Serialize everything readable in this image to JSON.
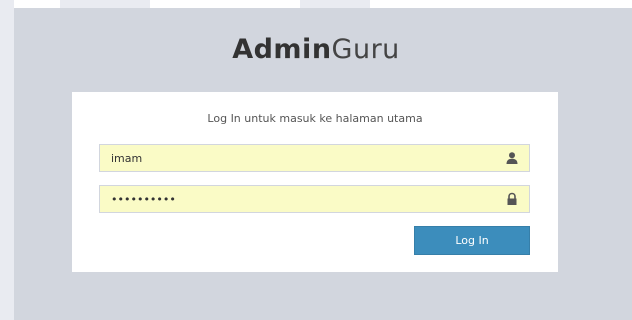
{
  "logo": {
    "bold": "Admin",
    "light": "Guru"
  },
  "login": {
    "message": "Log In untuk masuk ke halaman utama",
    "username_value": "imam",
    "password_value": "••••••••••",
    "submit_label": "Log In"
  },
  "icons": {
    "username": "user-icon",
    "password": "lock-icon"
  },
  "colors": {
    "background": "#d2d6de",
    "card": "#ffffff",
    "input_fill": "#fafbc6",
    "button": "#3c8dbc"
  }
}
